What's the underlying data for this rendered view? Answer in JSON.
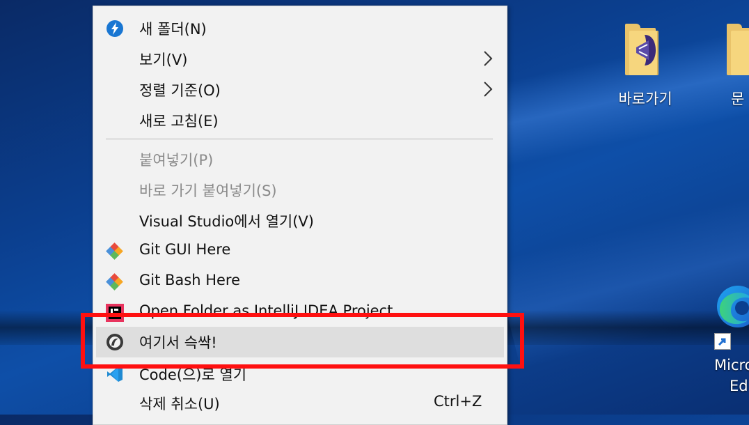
{
  "context_menu": {
    "items": [
      {
        "label": "새 폴더(N)",
        "icon": "bolt-circle-icon"
      },
      {
        "label": "보기(V)"
      },
      {
        "label": "정렬 기준(O)"
      },
      {
        "label": "새로 고침(E)"
      },
      {
        "label": "붙여넣기(P)",
        "disabled": true
      },
      {
        "label": "바로 가기 붙여넣기(S)",
        "disabled": true
      },
      {
        "label": "Visual Studio에서 열기(V)"
      },
      {
        "label": "Git GUI Here",
        "icon": "git-diamond-icon"
      },
      {
        "label": "Git Bash Here",
        "icon": "git-diamond-icon"
      },
      {
        "label": "Open Folder as IntelliJ IDEA Project",
        "icon": "intellij-icon"
      },
      {
        "label": "여기서 슥싹!",
        "icon": "circle-logo-icon",
        "highlighted": true
      },
      {
        "label": "Code(으)로 열기",
        "icon": "vscode-icon"
      },
      {
        "label": "삭제 취소(U)",
        "shortcut": "Ctrl+Z"
      }
    ]
  },
  "desktop": {
    "icons": [
      {
        "label": "바로가기",
        "icon": "folder-shortcut-icon"
      },
      {
        "label": "문",
        "icon": "folder-icon"
      },
      {
        "label": "Micro",
        "label2": "Ed",
        "icon": "edge-icon"
      }
    ]
  },
  "colors": {
    "highlight_box": "#ff1010",
    "menu_bg": "#f2f2f2",
    "hover_bg": "#dedede"
  }
}
